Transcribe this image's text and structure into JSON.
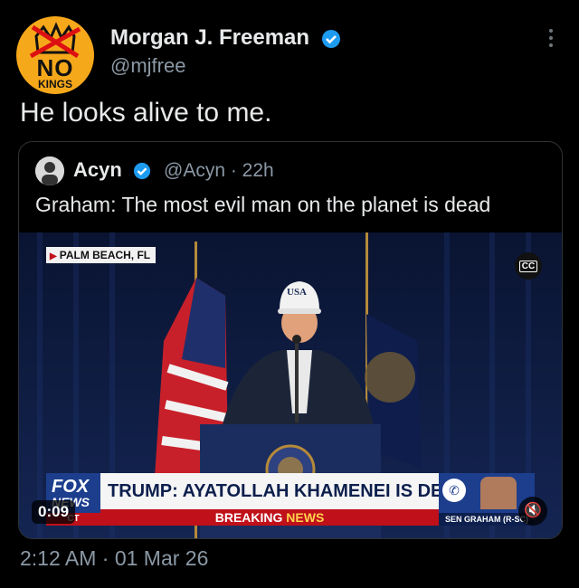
{
  "tweet": {
    "author_name": "Morgan J. Freeman",
    "author_handle": "@mjfree",
    "avatar_text_top": "NO",
    "avatar_text_bottom": "KINGS",
    "text": "He looks alive to me.",
    "timestamp": "2:12 AM · 01 Mar 26"
  },
  "quoted": {
    "author_name": "Acyn",
    "author_handle": "@Acyn · 22h",
    "text": "Graham: The most evil man on the planet is dead",
    "video": {
      "location": "PALM BEACH, FL",
      "cc_label": "CC",
      "fox_top": "FOX",
      "fox_bottom": "NEWS",
      "fox_strip": "CT",
      "headline": "TRUMP: AYATOLLAH KHAMENEI IS DEAD",
      "breaking_a": "BREAKING ",
      "breaking_b": "NEWS",
      "guest_caption": "SEN GRAHAM (R-SC)",
      "hat_text": "USA",
      "elapsed": "0:09"
    }
  },
  "colors": {
    "background": "#000000",
    "verified": "#1d9bf0",
    "secondary_text": "#8b98a5",
    "fox_blue": "#1c3e8d",
    "breaking_red": "#c0101a"
  },
  "icons": [
    "verified-badge-icon",
    "more-options-icon",
    "closed-captions-icon",
    "mute-icon",
    "phone-icon"
  ]
}
